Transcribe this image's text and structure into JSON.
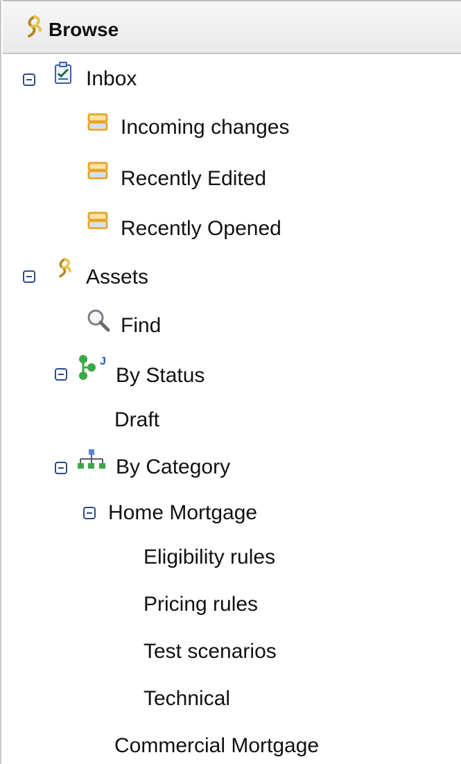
{
  "header": {
    "title": "Browse",
    "icon": "rules-sprig-icon"
  },
  "tree": {
    "inbox": {
      "label": "Inbox",
      "icon": "inbox-clipboard-icon",
      "children": [
        {
          "label": "Incoming changes",
          "icon": "inbox-list-icon"
        },
        {
          "label": "Recently Edited",
          "icon": "inbox-list-icon"
        },
        {
          "label": "Recently Opened",
          "icon": "inbox-list-icon"
        }
      ]
    },
    "assets": {
      "label": "Assets",
      "icon": "rules-sprig-icon",
      "find": {
        "label": "Find",
        "icon": "magnifier-icon"
      },
      "by_status": {
        "label": "By Status",
        "icon": "status-tree-icon",
        "children": [
          {
            "label": "Draft"
          }
        ]
      },
      "by_category": {
        "label": "By Category",
        "icon": "category-hierarchy-icon",
        "home_mortgage": {
          "label": "Home Mortgage",
          "children": [
            {
              "label": "Eligibility rules"
            },
            {
              "label": "Pricing rules"
            },
            {
              "label": "Test scenarios"
            },
            {
              "label": "Technical"
            }
          ]
        },
        "commercial_mortgage": {
          "label": "Commercial Mortgage"
        }
      }
    }
  },
  "colors": {
    "toggle": "#2b4a86",
    "list_icon": "#e3a72a",
    "sprig": "#e7c24a",
    "status_green": "#3aa845"
  }
}
